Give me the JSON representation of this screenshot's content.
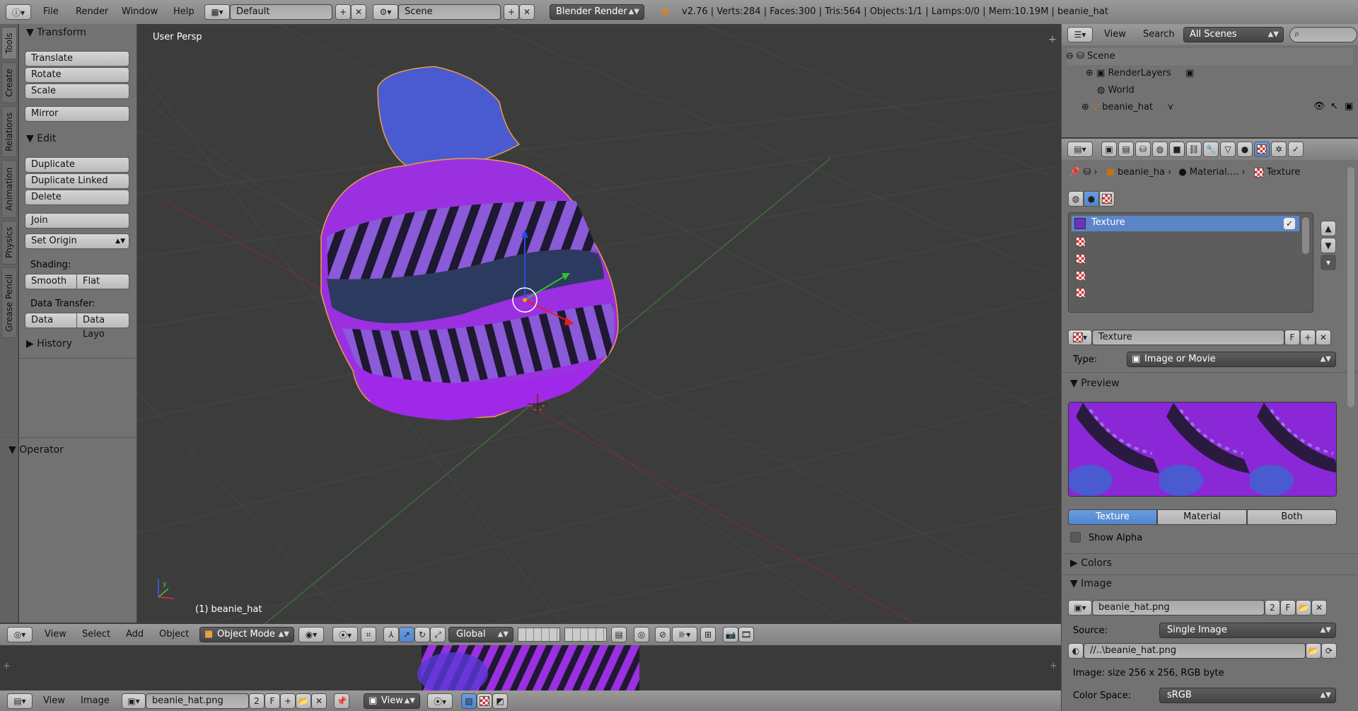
{
  "topbar": {
    "menus": [
      "File",
      "Render",
      "Window",
      "Help"
    ],
    "layout": "Default",
    "scene": "Scene",
    "engine": "Blender Render",
    "stats": "v2.76 | Verts:284 | Faces:300 | Tris:564 | Objects:1/1 | Lamps:0/0 | Mem:10.19M | beanie_hat"
  },
  "tabs": [
    "Tools",
    "Create",
    "Relations",
    "Animation",
    "Physics",
    "Grease Pencil"
  ],
  "toolshelf": {
    "transform_title": "Transform",
    "translate": "Translate",
    "rotate": "Rotate",
    "scale": "Scale",
    "mirror": "Mirror",
    "edit_title": "Edit",
    "duplicate": "Duplicate",
    "duplicate_linked": "Duplicate Linked",
    "delete": "Delete",
    "join": "Join",
    "set_origin": "Set Origin",
    "shading_label": "Shading:",
    "smooth": "Smooth",
    "flat": "Flat",
    "data_transfer_label": "Data Transfer:",
    "data": "Data",
    "data_layo": "Data Layo",
    "history_title": "History",
    "operator_title": "Operator"
  },
  "viewport": {
    "view_name": "User Persp",
    "object_label": "(1) beanie_hat"
  },
  "outliner": {
    "menus": [
      "View",
      "Search"
    ],
    "scope": "All Scenes",
    "rows": [
      "Scene",
      "RenderLayers",
      "World",
      "beanie_hat"
    ]
  },
  "props": {
    "breadcrumb": [
      "beanie_ha",
      "Material....",
      "Texture"
    ],
    "texture_slot": "Texture",
    "texture_name": "Texture",
    "f_label": "F",
    "type_label": "Type:",
    "type_value": "Image or Movie",
    "preview_title": "Preview",
    "seg_texture": "Texture",
    "seg_material": "Material",
    "seg_both": "Both",
    "show_alpha": "Show Alpha",
    "colors_title": "Colors",
    "image_title": "Image",
    "image_name": "beanie_hat.png",
    "image_users": "2",
    "source_label": "Source:",
    "source_value": "Single Image",
    "filepath": "//..\\beanie_hat.png",
    "image_info": "Image: size 256 x 256, RGB byte",
    "colorspace_label": "Color Space:",
    "colorspace_value": "sRGB"
  },
  "vp_header": {
    "menus": [
      "View",
      "Select",
      "Add",
      "Object"
    ],
    "mode": "Object Mode",
    "orientation": "Global"
  },
  "img_header": {
    "menus": [
      "View",
      "Image"
    ],
    "image_name": "beanie_hat.png",
    "users": "2",
    "f_label": "F",
    "view": "View"
  }
}
